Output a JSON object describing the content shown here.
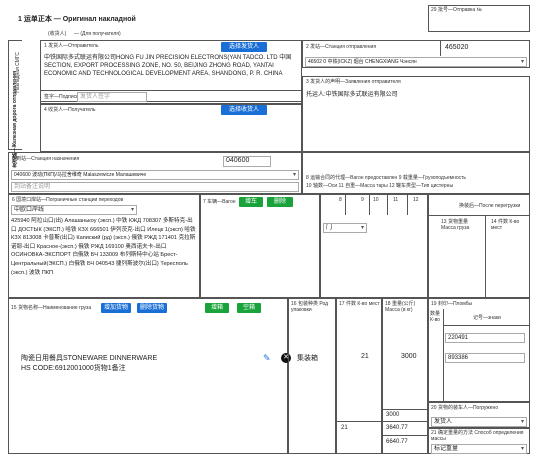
{
  "header": {
    "title": "1 运单正本 — Оригинал накладной",
    "sub1": "(收货人)",
    "sub2": "— (Для получателя)",
    "box29": "29 批号—Отправка №"
  },
  "sender": {
    "side_label": "发送路—Железная дорога отправления",
    "side_label2": "Накладная СМГС",
    "label": "1 发货人—Отправитель",
    "btn": "选择发货人",
    "address": "中铁国际多式联运有限公司HONG FU JIN PRECISION ELECTRONS(YAN TADCO. LTD 中国 SECTION, EXPORT PROCESSING ZONE, NO. 50, BEIJING ZHONG ROAD, YANTAI ECONOMIC AND TECHNOLOGICAL DEVELOPMENT AREA, SHANDONG, P. R. CHINA",
    "sign_label": "签字—Подпись",
    "sign_placeholder": "发货人签字"
  },
  "station_from": {
    "label": "2 发站—Станция отправления",
    "code": "465020",
    "name": "46502 0 中铁(ICKZ) 烟台 CHENGXIANG Чэнсян"
  },
  "sender_statement": {
    "label": "3 发货人的声明—Заявления отправителя",
    "value": "托运人:中铁国际多式联运有限公司"
  },
  "consignee": {
    "label": "4 收货人—Получатель",
    "btn": "选择收货人"
  },
  "station_to": {
    "label": "5 到站—Станция назначения",
    "code": "040600",
    "name": "040600 波动(ПКП)/马拉舍维奇 Malaszewicze Малашевиче",
    "note_placeholder": "到站备注说明"
  },
  "border": {
    "label": "6 国境口岸站—Пограничные станции переходов",
    "select": "中欧口岸线",
    "text": "425940 阿拉山口(出) Алашанькоу (эксп.) 中铁 КЖД 708307 多斯特克-出口 ДОСТЫК (ЭКСП.) 哈铁 КЗХ 666501 伊列茨克-出口 Илецк 1(эксп) 哈铁 КЗХ 813008 卡普斯(出口) Капиский (рд) (эксп.) 俄铁 РЖД 171401 克拉斯诺耶-出口 Красное-(эксп.) 俄铁 РЖД 169100 奥西诺夫卡-出口 ОСИНОВКА-ЭКСПОРТ 白俄铁 БЧ 133009 布列斯特中心站 Брест-Центральный(ЭКСП.) 白俄铁 БЧ 040543 捷列斯波尔(出口) Тересполь (эксп.) 波铁 ПКП"
  },
  "wagon": {
    "label": "7 车辆—Вагон",
    "btn_add": "增车",
    "btn_del": "删除",
    "cols": [
      "8",
      "9",
      "10",
      "11",
      "12"
    ],
    "select": "门",
    "box13": "13 货物重量 Масса груза",
    "box14": "14 件数 К-во мест"
  },
  "carrier": {
    "label": "8 运输合同的代理—Вагон предоставлен ",
    "label2": "9 载重量—Грузоподъемность",
    "label3": "10 轴数—Оси 11 自重—Масса тары 12 罐车类型—Тип цистерны"
  },
  "reload": {
    "label": "换装后—После перегрузки"
  },
  "goods": {
    "label": "15 货物名称—Наименование груза",
    "btn_add": "增加货物",
    "btn_del": "删除货物",
    "btn_add2": "增箱",
    "btn_del2": "空箱",
    "pack_label": "16 包装种类 Род упаковки",
    "count_label": "17 件数 К-во мест",
    "weight_label": "18 重量(公斤) Масса (в кг)",
    "seal_label": "19 封印—Пломбы",
    "seal_qty": "数量 К-во",
    "seal_mark": "记号—знаки",
    "name": "陶瓷日用餐具STONEWARE DINNERWARE",
    "hs": "HS CODE:6912001000货物1备注",
    "pack": "集装箱",
    "count": "21",
    "weight": "3000",
    "seal1": "220491",
    "seal2": "893386"
  },
  "totals": {
    "w1": "3000",
    "w2": "3640.77",
    "w3": "6640.77",
    "c1": "21",
    "load_label": "20 货物的装车人—Погружено",
    "load_value": "发货人",
    "method_label": "21 确定重量的方法 Способ определения массы",
    "method_value": "标记重量"
  },
  "colors": {
    "blue": "#1a6fd6",
    "green": "#1aa33a"
  }
}
